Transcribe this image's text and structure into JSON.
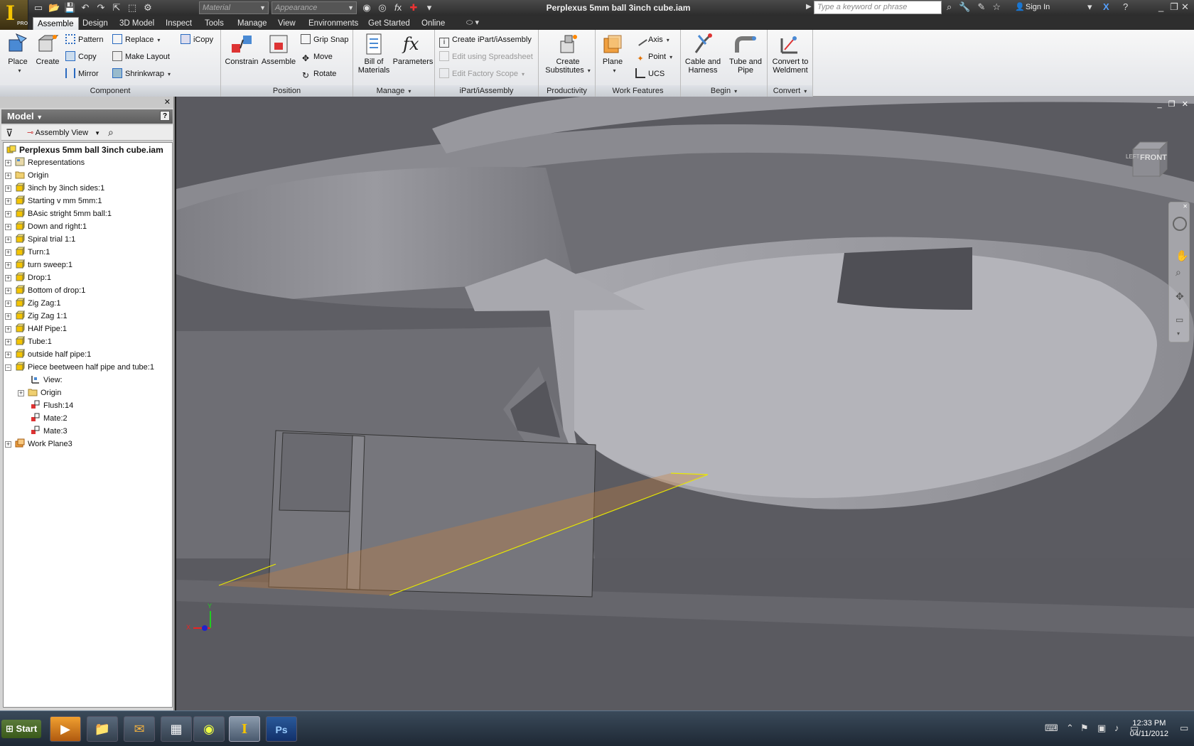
{
  "window": {
    "title": "Perplexus 5mm ball 3inch cube.iam",
    "search_placeholder": "Type a keyword or phrase",
    "sign_in": "Sign In",
    "material_placeholder": "Material",
    "appearance_placeholder": "Appearance",
    "app_badge": "PRO"
  },
  "tabs": [
    "Assemble",
    "Design",
    "3D Model",
    "Inspect",
    "Tools",
    "Manage",
    "View",
    "Environments",
    "Get Started",
    "Online"
  ],
  "ribbon": {
    "component": {
      "label": "Component",
      "place": "Place",
      "create": "Create",
      "pattern": "Pattern",
      "copy": "Copy",
      "mirror": "Mirror",
      "replace": "Replace",
      "make_layout": "Make Layout",
      "shrinkwrap": "Shrinkwrap",
      "icopy": "iCopy"
    },
    "position": {
      "label": "Position",
      "constrain": "Constrain",
      "assemble": "Assemble",
      "grip_snap": "Grip Snap",
      "move": "Move",
      "rotate": "Rotate"
    },
    "manage": {
      "label": "Manage",
      "bom_line1": "Bill of",
      "bom_line2": "Materials",
      "parameters": "Parameters"
    },
    "ipart": {
      "label": "iPart/iAssembly",
      "create": "Create iPart/iAssembly",
      "edit_spreadsheet": "Edit using Spreadsheet",
      "edit_factory": "Edit Factory Scope"
    },
    "productivity": {
      "label": "Productivity",
      "line1": "Create",
      "line2": "Substitutes"
    },
    "work_features": {
      "label": "Work Features",
      "plane": "Plane",
      "axis": "Axis",
      "point": "Point",
      "ucs": "UCS"
    },
    "begin": {
      "label": "Begin",
      "cable_line1": "Cable and",
      "cable_line2": "Harness",
      "tube_line1": "Tube and",
      "tube_line2": "Pipe"
    },
    "convert": {
      "label": "Convert",
      "line1": "Convert to",
      "line2": "Weldment"
    }
  },
  "browser": {
    "header": "Model",
    "view_mode": "Assembly View",
    "help": "?",
    "root": "Perplexus 5mm ball 3inch cube.iam",
    "nodes": [
      {
        "label": "Representations",
        "icon": "representations-icon"
      },
      {
        "label": "Origin",
        "icon": "folder-icon"
      },
      {
        "label": "3inch by 3inch sides:1",
        "icon": "part-icon"
      },
      {
        "label": "Starting v mm 5mm:1",
        "icon": "part-icon"
      },
      {
        "label": "BAsic stright 5mm ball:1",
        "icon": "part-icon"
      },
      {
        "label": "Down and right:1",
        "icon": "part-icon"
      },
      {
        "label": "Spiral trial 1:1",
        "icon": "part-icon"
      },
      {
        "label": "Turn:1",
        "icon": "part-icon"
      },
      {
        "label": "turn sweep:1",
        "icon": "part-icon"
      },
      {
        "label": "Drop:1",
        "icon": "part-icon"
      },
      {
        "label": "Bottom of drop:1",
        "icon": "part-icon"
      },
      {
        "label": "Zig Zag:1",
        "icon": "part-icon"
      },
      {
        "label": "Zig Zag 1:1",
        "icon": "part-icon"
      },
      {
        "label": "HAlf Pipe:1",
        "icon": "part-icon"
      },
      {
        "label": "Tube:1",
        "icon": "part-icon"
      },
      {
        "label": "outside half pipe:1",
        "icon": "part-icon"
      },
      {
        "label": "Piece beetween half pipe and tube:1",
        "icon": "part-icon"
      }
    ],
    "children": [
      {
        "label": "View:",
        "icon": "view-icon"
      },
      {
        "label": "Origin",
        "icon": "folder-icon"
      },
      {
        "label": "Flush:14",
        "icon": "constraint-icon"
      },
      {
        "label": "Mate:2",
        "icon": "constraint-icon"
      },
      {
        "label": "Mate:3",
        "icon": "constraint-icon"
      }
    ],
    "last": {
      "label": "Work Plane3",
      "icon": "workplane-icon"
    }
  },
  "viewcube": {
    "face": "FRONT",
    "left": "LEFT"
  },
  "triad": {
    "x": "X",
    "y": "Y"
  },
  "taskbar": {
    "start": "Start",
    "time": "12:33 PM",
    "date": "04/11/2012"
  },
  "colors": {
    "accent": "#f5c400",
    "viewport": "#59595e",
    "workplane": "#e8e800"
  }
}
